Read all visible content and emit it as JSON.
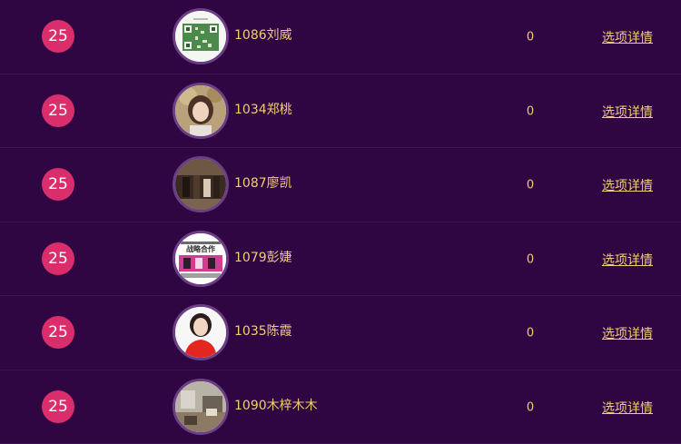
{
  "list": {
    "rows": [
      {
        "rank": "25",
        "name": "1086刘威",
        "votes": "0",
        "detail": "选项详情",
        "avatar": "qr-code-photo"
      },
      {
        "rank": "25",
        "name": "1034郑桃",
        "votes": "0",
        "detail": "选项详情",
        "avatar": "woman-portrait-photo"
      },
      {
        "rank": "25",
        "name": "1087廖凯",
        "votes": "0",
        "detail": "选项详情",
        "avatar": "indoor-group-photo"
      },
      {
        "rank": "25",
        "name": "1079彭婕",
        "votes": "0",
        "detail": "选项详情",
        "avatar": "event-banner-photo"
      },
      {
        "rank": "25",
        "name": "1035陈霞",
        "votes": "0",
        "detail": "选项详情",
        "avatar": "woman-red-dress-photo"
      },
      {
        "rank": "25",
        "name": "1090木梓木木",
        "votes": "0",
        "detail": "选项详情",
        "avatar": "interior-room-photo"
      }
    ]
  },
  "avatar_texts": {
    "banner": "战略合作"
  },
  "colors": {
    "background": "#2f0642",
    "rank_badge": "#d92e6b",
    "text_gold": "#f2cd74",
    "avatar_ring": "#6b3f86"
  }
}
